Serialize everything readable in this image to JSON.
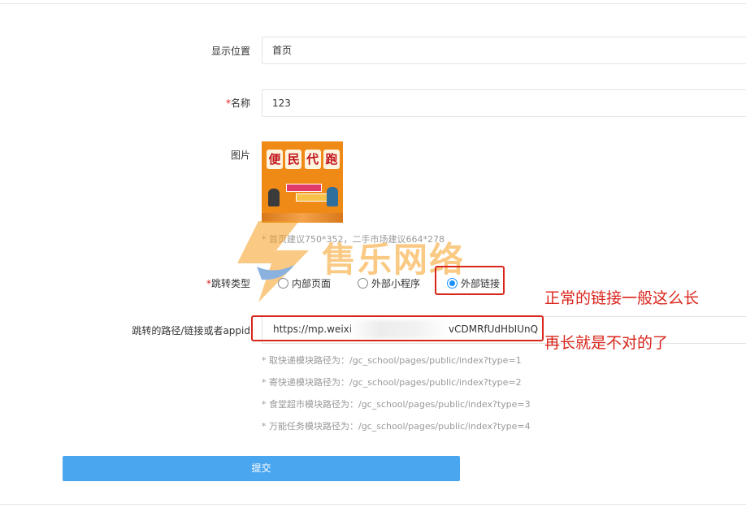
{
  "form": {
    "position": {
      "label": "显示位置",
      "value": "首页"
    },
    "name": {
      "required_mark": "*",
      "label": "名称",
      "value": "123"
    },
    "image": {
      "label": "图片",
      "picture_text": "便民代跑",
      "hint": "* 首页建议750*352，二手市场建议664*278"
    },
    "jump_type": {
      "required_mark": "*",
      "label": "跳转类型",
      "options": [
        {
          "label": "内部页面",
          "selected": false
        },
        {
          "label": "外部小程序",
          "selected": false
        },
        {
          "label": "外部链接",
          "selected": true
        }
      ]
    },
    "path": {
      "label": "跳转的路径/链接或者appid",
      "value_start": "https://mp.weixi",
      "value_end": "vCDMRfUdHbIUnQ"
    },
    "path_hints": [
      "* 取快递模块路径为：/gc_school/pages/public/index?type=1",
      "* 寄快递模块路径为：/gc_school/pages/public/index?type=2",
      "* 食堂超市模块路径为：/gc_school/pages/public/index?type=3",
      "* 万能任务模块路径为：/gc_school/pages/public/index?type=4"
    ],
    "submit_label": "提交"
  },
  "annotations": {
    "note_normal": "正常的链接一般这么长",
    "note_longer": "再长就是不对的了",
    "highlight_color": "#d9261c"
  },
  "watermark": {
    "text": "售乐网络"
  },
  "colors": {
    "primary": "#4aa6ef",
    "radio_active": "#1890ff",
    "required": "#e02020"
  }
}
